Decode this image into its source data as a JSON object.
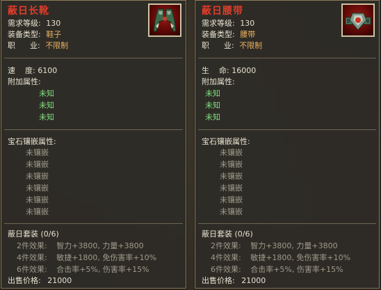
{
  "left": {
    "title": "蔽日长靴",
    "req_level_label": "需求等级:",
    "req_level": "130",
    "equip_type_label": "装备类型:",
    "equip_type": "鞋子",
    "job_label": "职      业:",
    "job": "不限制",
    "stat_label": "速    度:",
    "stat_value": "6100",
    "extra_label": "附加属性:",
    "extra": [
      "未知",
      "未知",
      "未知"
    ],
    "gem_label": "宝石镶嵌属性:",
    "gems": [
      "未镶嵌",
      "未镶嵌",
      "未镶嵌",
      "未镶嵌",
      "未镶嵌",
      "未镶嵌"
    ],
    "set_label": "蔽日套装 (0/6)",
    "set_effects": [
      {
        "label": "2件效果:",
        "value": "智力+3800, 力量+3800"
      },
      {
        "label": "4件效果:",
        "value": "敏捷+1800, 免伤害率+10%"
      },
      {
        "label": "6件效果:",
        "value": "合击率+5%, 伤害率+15%"
      }
    ],
    "price_label": "出售价格:",
    "price": "21000"
  },
  "right": {
    "title": "蔽日腰带",
    "req_level_label": "需求等级:",
    "req_level": "130",
    "equip_type_label": "装备类型:",
    "equip_type": "腰带",
    "job_label": "职      业:",
    "job": "不限制",
    "stat_label": "生    命:",
    "stat_value": "16000",
    "extra_label": "附加属性:",
    "extra": [
      "未知",
      "未知",
      "未知"
    ],
    "gem_label": "宝石镶嵌属性:",
    "gems": [
      "未镶嵌",
      "未镶嵌",
      "未镶嵌",
      "未镶嵌",
      "未镶嵌",
      "未镶嵌"
    ],
    "set_label": "蔽日套装 (0/6)",
    "set_effects": [
      {
        "label": "2件效果:",
        "value": "智力+3800, 力量+3800"
      },
      {
        "label": "4件效果:",
        "value": "敏捷+1800, 免伤害率+10%"
      },
      {
        "label": "6件效果:",
        "value": "合击率+5%, 伤害率+15%"
      }
    ],
    "price_label": "出售价格:",
    "price": "21000"
  },
  "icons": {
    "left": "boots-icon",
    "right": "belt-icon"
  },
  "colors": {
    "title": "#e03c2a",
    "value_orange": "#e8b060",
    "unknown_green": "#7fe07f",
    "inactive_grey": "#9e9a8c"
  }
}
